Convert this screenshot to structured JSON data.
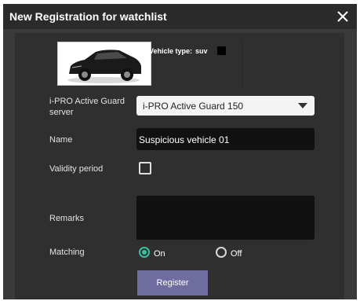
{
  "dialog": {
    "title": "New Registration for watchlist",
    "close_icon": "close-icon"
  },
  "vehicle": {
    "thumbnail_icon": "vehicle-thumbnail",
    "type_label": "Vehicle type:",
    "type_value": "suv",
    "color_swatch": "#000000"
  },
  "form": {
    "server_label": "i-PRO Active Guard server",
    "server_value": "i-PRO Active Guard 150",
    "name_label": "Name",
    "name_value": "Suspicious vehicle 01",
    "validity_label": "Validity period",
    "remarks_label": "Remarks",
    "remarks_value": "",
    "matching_label": "Matching",
    "matching_on_label": "On",
    "matching_off_label": "Off",
    "matching_selected": "On"
  },
  "actions": {
    "register_label": "Register"
  },
  "colors": {
    "accent_radio": "#3bbf9f",
    "button": "#6f6ca0",
    "dialog_bg": "#3a3a3a",
    "title_bg": "#2b2b2b"
  }
}
